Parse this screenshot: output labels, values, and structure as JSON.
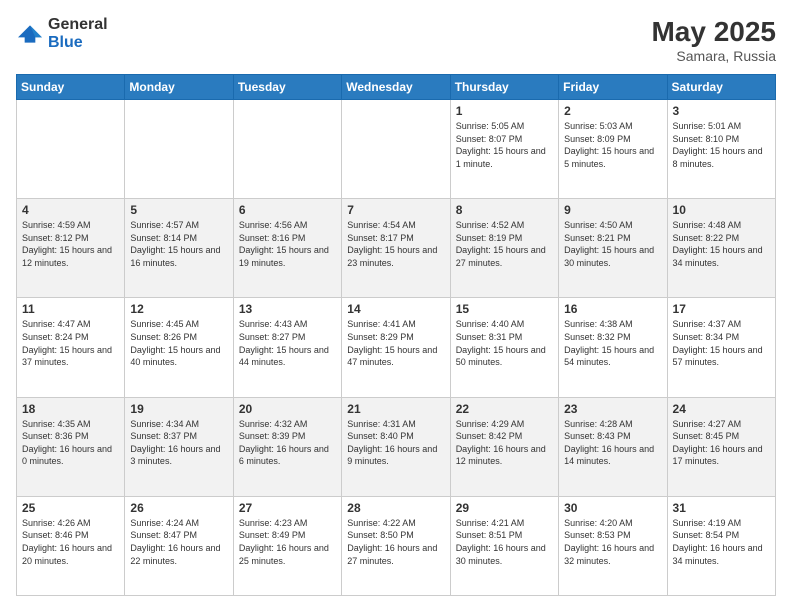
{
  "header": {
    "logo": {
      "general": "General",
      "blue": "Blue"
    },
    "title": "May 2025",
    "subtitle": "Samara, Russia"
  },
  "weekdays": [
    "Sunday",
    "Monday",
    "Tuesday",
    "Wednesday",
    "Thursday",
    "Friday",
    "Saturday"
  ],
  "weeks": [
    [
      null,
      null,
      null,
      null,
      {
        "day": "1",
        "sunrise": "5:05 AM",
        "sunset": "8:07 PM",
        "daylight": "15 hours and 1 minute."
      },
      {
        "day": "2",
        "sunrise": "5:03 AM",
        "sunset": "8:09 PM",
        "daylight": "15 hours and 5 minutes."
      },
      {
        "day": "3",
        "sunrise": "5:01 AM",
        "sunset": "8:10 PM",
        "daylight": "15 hours and 8 minutes."
      }
    ],
    [
      {
        "day": "4",
        "sunrise": "4:59 AM",
        "sunset": "8:12 PM",
        "daylight": "15 hours and 12 minutes."
      },
      {
        "day": "5",
        "sunrise": "4:57 AM",
        "sunset": "8:14 PM",
        "daylight": "15 hours and 16 minutes."
      },
      {
        "day": "6",
        "sunrise": "4:56 AM",
        "sunset": "8:16 PM",
        "daylight": "15 hours and 19 minutes."
      },
      {
        "day": "7",
        "sunrise": "4:54 AM",
        "sunset": "8:17 PM",
        "daylight": "15 hours and 23 minutes."
      },
      {
        "day": "8",
        "sunrise": "4:52 AM",
        "sunset": "8:19 PM",
        "daylight": "15 hours and 27 minutes."
      },
      {
        "day": "9",
        "sunrise": "4:50 AM",
        "sunset": "8:21 PM",
        "daylight": "15 hours and 30 minutes."
      },
      {
        "day": "10",
        "sunrise": "4:48 AM",
        "sunset": "8:22 PM",
        "daylight": "15 hours and 34 minutes."
      }
    ],
    [
      {
        "day": "11",
        "sunrise": "4:47 AM",
        "sunset": "8:24 PM",
        "daylight": "15 hours and 37 minutes."
      },
      {
        "day": "12",
        "sunrise": "4:45 AM",
        "sunset": "8:26 PM",
        "daylight": "15 hours and 40 minutes."
      },
      {
        "day": "13",
        "sunrise": "4:43 AM",
        "sunset": "8:27 PM",
        "daylight": "15 hours and 44 minutes."
      },
      {
        "day": "14",
        "sunrise": "4:41 AM",
        "sunset": "8:29 PM",
        "daylight": "15 hours and 47 minutes."
      },
      {
        "day": "15",
        "sunrise": "4:40 AM",
        "sunset": "8:31 PM",
        "daylight": "15 hours and 50 minutes."
      },
      {
        "day": "16",
        "sunrise": "4:38 AM",
        "sunset": "8:32 PM",
        "daylight": "15 hours and 54 minutes."
      },
      {
        "day": "17",
        "sunrise": "4:37 AM",
        "sunset": "8:34 PM",
        "daylight": "15 hours and 57 minutes."
      }
    ],
    [
      {
        "day": "18",
        "sunrise": "4:35 AM",
        "sunset": "8:36 PM",
        "daylight": "16 hours and 0 minutes."
      },
      {
        "day": "19",
        "sunrise": "4:34 AM",
        "sunset": "8:37 PM",
        "daylight": "16 hours and 3 minutes."
      },
      {
        "day": "20",
        "sunrise": "4:32 AM",
        "sunset": "8:39 PM",
        "daylight": "16 hours and 6 minutes."
      },
      {
        "day": "21",
        "sunrise": "4:31 AM",
        "sunset": "8:40 PM",
        "daylight": "16 hours and 9 minutes."
      },
      {
        "day": "22",
        "sunrise": "4:29 AM",
        "sunset": "8:42 PM",
        "daylight": "16 hours and 12 minutes."
      },
      {
        "day": "23",
        "sunrise": "4:28 AM",
        "sunset": "8:43 PM",
        "daylight": "16 hours and 14 minutes."
      },
      {
        "day": "24",
        "sunrise": "4:27 AM",
        "sunset": "8:45 PM",
        "daylight": "16 hours and 17 minutes."
      }
    ],
    [
      {
        "day": "25",
        "sunrise": "4:26 AM",
        "sunset": "8:46 PM",
        "daylight": "16 hours and 20 minutes."
      },
      {
        "day": "26",
        "sunrise": "4:24 AM",
        "sunset": "8:47 PM",
        "daylight": "16 hours and 22 minutes."
      },
      {
        "day": "27",
        "sunrise": "4:23 AM",
        "sunset": "8:49 PM",
        "daylight": "16 hours and 25 minutes."
      },
      {
        "day": "28",
        "sunrise": "4:22 AM",
        "sunset": "8:50 PM",
        "daylight": "16 hours and 27 minutes."
      },
      {
        "day": "29",
        "sunrise": "4:21 AM",
        "sunset": "8:51 PM",
        "daylight": "16 hours and 30 minutes."
      },
      {
        "day": "30",
        "sunrise": "4:20 AM",
        "sunset": "8:53 PM",
        "daylight": "16 hours and 32 minutes."
      },
      {
        "day": "31",
        "sunrise": "4:19 AM",
        "sunset": "8:54 PM",
        "daylight": "16 hours and 34 minutes."
      }
    ]
  ]
}
